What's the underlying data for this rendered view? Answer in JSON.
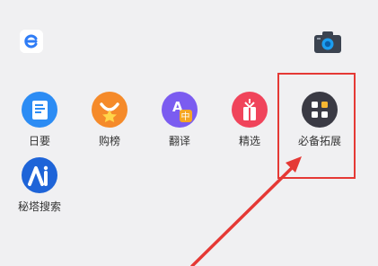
{
  "top_bar": {
    "logo_icon": "edge-e-logo-icon",
    "camera_icon": "camera-icon"
  },
  "apps": [
    {
      "label": "日要",
      "icon": "daily-news-icon",
      "color": "#2c8cf4"
    },
    {
      "label": "购榜",
      "icon": "shopping-bag-icon",
      "color": "#f58a2a"
    },
    {
      "label": "翻译",
      "icon": "translate-icon",
      "color": "#7b5cf0"
    },
    {
      "label": "精选",
      "icon": "gift-icon",
      "color": "#f0445b"
    },
    {
      "label": "必备拓展",
      "icon": "extensions-icon",
      "color": "#3a3a44"
    },
    {
      "label": "秘塔搜索",
      "icon": "metaso-search-icon",
      "color": "#1e64d8"
    }
  ],
  "annotation": {
    "highlight_color": "#e53935"
  }
}
